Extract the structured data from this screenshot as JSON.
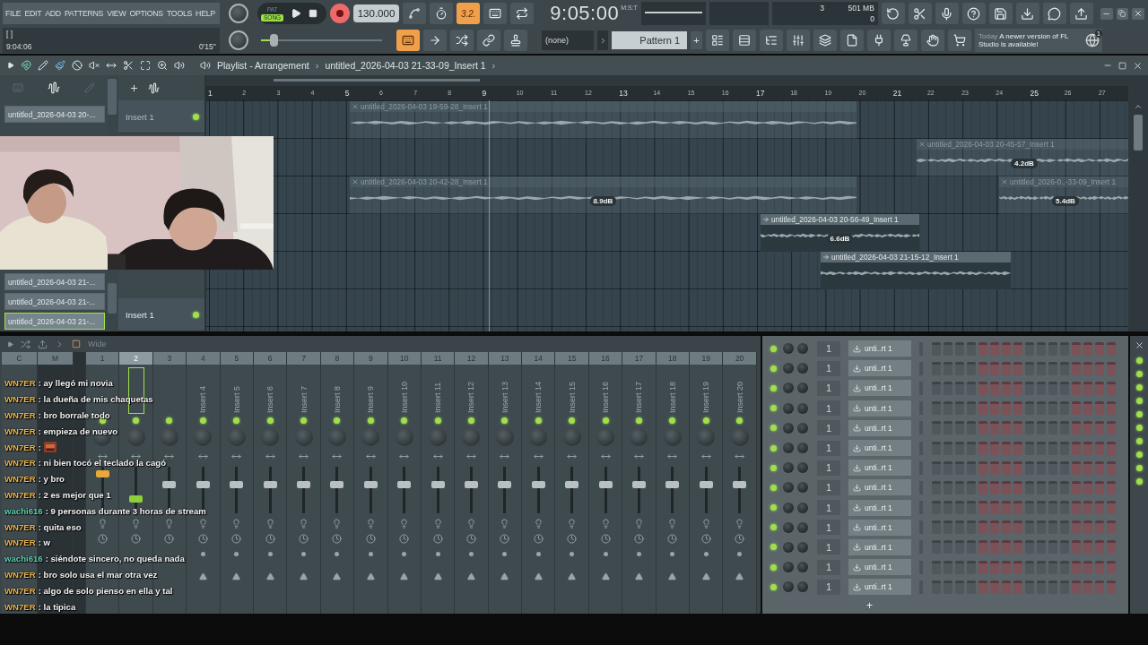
{
  "menu": [
    "FILE",
    "EDIT",
    "ADD",
    "PATTERNS",
    "VIEW",
    "OPTIONS",
    "TOOLS",
    "HELP"
  ],
  "transport": {
    "modes": [
      {
        "label": "PAT",
        "selected": false
      },
      {
        "label": "SONG",
        "selected": true
      }
    ],
    "recording": true,
    "tempo": "130.000",
    "time": "9:05:00",
    "time_format": "M:S:T"
  },
  "tools_top": [
    {
      "on": false
    },
    {
      "on": false
    },
    {
      "on": true,
      "label": "3.2."
    },
    {
      "on": false
    },
    {
      "on": false
    }
  ],
  "hint_panel": {
    "brackets": "[ ]",
    "clock": "9:04:06",
    "duration": "0'15''"
  },
  "master_pitch": {
    "level": 0.1
  },
  "tools_bottom": [
    {
      "on": true
    },
    {
      "on": false
    },
    {
      "on": false
    },
    {
      "on": false
    },
    {
      "on": false
    }
  ],
  "cpu": {
    "polyphony": "3",
    "memory": "501 MB",
    "value": "0"
  },
  "pattern_selector": {
    "preset": "(none)",
    "pattern": "Pattern 1",
    "add": "+"
  },
  "notification": {
    "when": "Today",
    "message": "A newer version of FL Studio is available!",
    "count": "1"
  },
  "playlist": {
    "title": "Playlist - Arrangement",
    "separator": "›",
    "path": "untitled_2026-04-03 21-33-09_Insert 1",
    "picker": [
      {
        "label": "untitled_2026-04-03 20-...",
        "selected": false
      },
      {
        "label": "untitled_2026-04-03 21-...",
        "selected": false
      },
      {
        "label": "untitled_2026-04-03 21-...",
        "selected": false
      },
      {
        "label": "untitled_2026-04-03 21-...",
        "selected": true
      }
    ],
    "tracks": [
      {
        "name": "Insert 1"
      },
      {
        "name": "Insert 1"
      }
    ],
    "bars": [
      "1",
      "2",
      "3",
      "4",
      "5",
      "6",
      "7",
      "8",
      "9",
      "10",
      "11",
      "12",
      "13",
      "14",
      "15",
      "16",
      "17",
      "18",
      "19",
      "20",
      "21",
      "22",
      "23",
      "24",
      "25",
      "26",
      "27"
    ],
    "clips": [
      {
        "name": "untitled_2026-04-03 19-59-28_Insert 1",
        "muted": true
      },
      {
        "name": "untitled_2026-04-03 20-45-57_Insert 1",
        "muted": true,
        "gain": "4.2dB"
      },
      {
        "name": "untitled_2026-04-03 20-42-28_Insert 1",
        "muted": true,
        "gain": "8.9dB"
      },
      {
        "name": "untitled_2026-0..-33-09_Insert 1",
        "muted": true,
        "gain": "5.4dB"
      },
      {
        "name": "untitled_2026-04-03 20-56-49_Insert 1",
        "muted": false,
        "gain": "6.6dB"
      },
      {
        "name": "untitled_2026-04-03 21-15-12_Insert 1",
        "muted": false
      }
    ]
  },
  "mixer": {
    "mode": "Wide",
    "columns": [
      "C",
      "M"
    ],
    "inserts": [
      {
        "number": "1",
        "selected": false,
        "level": 0.85,
        "color": "#e8a83a"
      },
      {
        "number": "2",
        "selected": true,
        "level": 0.3,
        "color": "#8ccf3a"
      },
      {
        "number": "3",
        "selected": false,
        "level": 0.62,
        "color": "#b9c0c4"
      },
      {
        "number": "4",
        "label": "Insert 4",
        "selected": false,
        "level": 0.62,
        "color": "#b9c0c4"
      },
      {
        "number": "5",
        "label": "Insert 5",
        "selected": false,
        "level": 0.62,
        "color": "#b9c0c4"
      },
      {
        "number": "6",
        "label": "Insert 6",
        "selected": false,
        "level": 0.62,
        "color": "#b9c0c4"
      },
      {
        "number": "7",
        "label": "Insert 7",
        "selected": false,
        "level": 0.62,
        "color": "#b9c0c4"
      },
      {
        "number": "8",
        "label": "Insert 8",
        "selected": false,
        "level": 0.62,
        "color": "#b9c0c4"
      },
      {
        "number": "9",
        "label": "Insert 9",
        "selected": false,
        "level": 0.62,
        "color": "#b9c0c4"
      },
      {
        "number": "10",
        "label": "Insert 10",
        "selected": false,
        "level": 0.62,
        "color": "#b9c0c4"
      },
      {
        "number": "11",
        "label": "Insert 11",
        "selected": false,
        "level": 0.62,
        "color": "#b9c0c4"
      },
      {
        "number": "12",
        "label": "Insert 12",
        "selected": false,
        "level": 0.62,
        "color": "#b9c0c4"
      },
      {
        "number": "13",
        "label": "Insert 13",
        "selected": false,
        "level": 0.62,
        "color": "#b9c0c4"
      },
      {
        "number": "14",
        "label": "Insert 14",
        "selected": false,
        "level": 0.62,
        "color": "#b9c0c4"
      },
      {
        "number": "15",
        "label": "Insert 15",
        "selected": false,
        "level": 0.62,
        "color": "#b9c0c4"
      },
      {
        "number": "16",
        "label": "Insert 16",
        "selected": false,
        "level": 0.62,
        "color": "#b9c0c4"
      },
      {
        "number": "17",
        "label": "Insert 17",
        "selected": false,
        "level": 0.62,
        "color": "#b9c0c4"
      },
      {
        "number": "18",
        "label": "Insert 18",
        "selected": false,
        "level": 0.62,
        "color": "#b9c0c4"
      },
      {
        "number": "19",
        "label": "Insert 19",
        "selected": false,
        "level": 0.62,
        "color": "#b9c0c4"
      },
      {
        "number": "20",
        "label": "Insert 20",
        "selected": false,
        "level": 0.62,
        "color": "#b9c0c4"
      }
    ]
  },
  "channel_rack": {
    "add": "+",
    "channels": [
      {
        "on": true,
        "number": "1",
        "name": "unti..rt 1"
      },
      {
        "on": true,
        "number": "1",
        "name": "unti..rt 1"
      },
      {
        "on": true,
        "number": "1",
        "name": "unti..rt 1"
      },
      {
        "on": true,
        "number": "1",
        "name": "unti..rt 1"
      },
      {
        "on": true,
        "number": "1",
        "name": "unti..rt 1"
      },
      {
        "on": true,
        "number": "1",
        "name": "unti..rt 1"
      },
      {
        "on": true,
        "number": "1",
        "name": "unti..rt 1"
      },
      {
        "on": true,
        "number": "1",
        "name": "unti..rt 1"
      },
      {
        "on": true,
        "number": "1",
        "name": "unti..rt 1"
      },
      {
        "on": true,
        "number": "1",
        "name": "unti..rt 1"
      },
      {
        "on": true,
        "number": "1",
        "name": "unti..rt 1"
      },
      {
        "on": true,
        "number": "1",
        "name": "unti..rt 1"
      },
      {
        "on": true,
        "number": "1",
        "name": "unti..rt 1"
      }
    ]
  },
  "chat": [
    {
      "user": "WN7ER",
      "color": "#e9b44c",
      "text": ": ay llegó mi novia"
    },
    {
      "user": "WN7ER",
      "color": "#e9b44c",
      "text": ": la dueña de mis chaquetas"
    },
    {
      "user": "WN7ER",
      "color": "#e9b44c",
      "text": ": bro borrale todo"
    },
    {
      "user": "WN7ER",
      "color": "#e9b44c",
      "text": ": empieza de nuevo"
    },
    {
      "user": "WN7ER",
      "color": "#e9b44c",
      "text": ":",
      "kind": "emote"
    },
    {
      "user": "WN7ER",
      "color": "#e9b44c",
      "text": ": ni bien tocó el teclado la cagó"
    },
    {
      "user": "WN7ER",
      "color": "#e9b44c",
      "text": ": y bro"
    },
    {
      "user": "WN7ER",
      "color": "#e9b44c",
      "text": ": 2 es mejor que 1"
    },
    {
      "user": "wachi616",
      "color": "#5fd0b0",
      "text": ": 9 personas durante 3 horas de stream"
    },
    {
      "user": "WN7ER",
      "color": "#e9b44c",
      "text": ": quita eso"
    },
    {
      "user": "WN7ER",
      "color": "#e9b44c",
      "text": ": w"
    },
    {
      "user": "wachi616",
      "color": "#5fd0b0",
      "text": ": siéndote sincero, no queda nada"
    },
    {
      "user": "WN7ER",
      "color": "#e9b44c",
      "text": ": bro solo usa el mar otra vez"
    },
    {
      "user": "WN7ER",
      "color": "#e9b44c",
      "text": ": algo de solo pienso en ella y tal"
    },
    {
      "user": "WN7ER",
      "color": "#e9b44c",
      "text": ": la tipica"
    }
  ]
}
